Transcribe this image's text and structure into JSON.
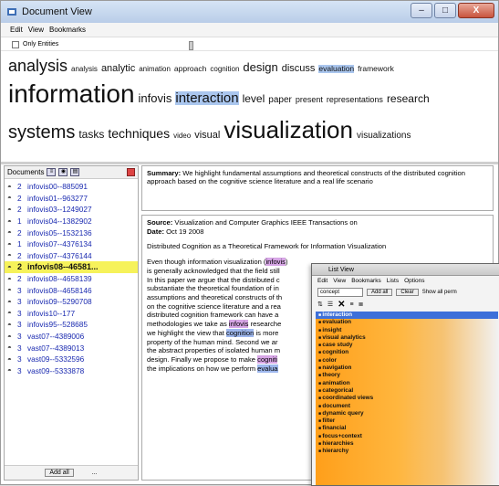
{
  "window": {
    "title": "Document View",
    "buttons": [
      "–",
      "□",
      "X"
    ]
  },
  "menu": [
    "Edit",
    "View",
    "Bookmarks"
  ],
  "options": {
    "only_entities_label": "Only Entities"
  },
  "cloud": {
    "line1": [
      {
        "text": "analysis",
        "size": 18
      },
      {
        "text": "analysis",
        "size": 8
      },
      {
        "text": "analytic",
        "size": 11
      },
      {
        "text": "animation",
        "size": 8
      },
      {
        "text": "approach",
        "size": 8.5
      },
      {
        "text": "cognition",
        "size": 8
      },
      {
        "text": "design",
        "size": 13
      },
      {
        "text": "discuss",
        "size": 11
      },
      {
        "text": "evaluation",
        "size": 8.5,
        "highlight": true
      },
      {
        "text": "framework",
        "size": 8.5
      }
    ],
    "line2": [
      {
        "text": "information",
        "size": 28
      },
      {
        "text": "infovis",
        "size": 13
      },
      {
        "text": "interaction",
        "size": 15,
        "highlight": true
      },
      {
        "text": "level",
        "size": 12
      },
      {
        "text": "paper",
        "size": 10
      },
      {
        "text": "present",
        "size": 9
      },
      {
        "text": "representations",
        "size": 9
      },
      {
        "text": "research",
        "size": 12
      }
    ],
    "line3": [
      {
        "text": "systems",
        "size": 20
      },
      {
        "text": "tasks",
        "size": 12
      },
      {
        "text": "techniques",
        "size": 14
      },
      {
        "text": "video",
        "size": 8
      },
      {
        "text": "visual",
        "size": 11
      },
      {
        "text": "visualization",
        "size": 26
      },
      {
        "text": "visualizations",
        "size": 10
      }
    ]
  },
  "documents": {
    "header": "Documents",
    "add_all_label": "Add all",
    "more_label": "...",
    "items": [
      {
        "count": "2",
        "name": "infovis00--885091"
      },
      {
        "count": "2",
        "name": "infovis01--963277"
      },
      {
        "count": "2",
        "name": "infovis03--1249027"
      },
      {
        "count": "1",
        "name": "infovis04--1382902"
      },
      {
        "count": "2",
        "name": "infovis05--1532136"
      },
      {
        "count": "1",
        "name": "infovis07--4376134"
      },
      {
        "count": "2",
        "name": "infovis07--4376144"
      },
      {
        "count": "2",
        "name": "infovis08--46581...",
        "selected": true
      },
      {
        "count": "2",
        "name": "infovis08--4658139"
      },
      {
        "count": "3",
        "name": "infovis08--4658146"
      },
      {
        "count": "3",
        "name": "infovis09--5290708"
      },
      {
        "count": "3",
        "name": "infovis10--177"
      },
      {
        "count": "3",
        "name": "infovis95--528685"
      },
      {
        "count": "3",
        "name": "vast07--4389006"
      },
      {
        "count": "3",
        "name": "vast07--4389013"
      },
      {
        "count": "3",
        "name": "vast09--5332596"
      },
      {
        "count": "3",
        "name": "vast09--5333878"
      }
    ]
  },
  "summary": {
    "label": "Summary:",
    "text": "We highlight fundamental assumptions and theoretical constructs of the distributed cognition approach based on the cognitive science literature and a real life scenario"
  },
  "source": {
    "source_label": "Source:",
    "source_text": "Visualization and Computer Graphics IEEE Transactions on",
    "date_label": "Date:",
    "date_text": "Oct 19 2008",
    "doc_title": "Distributed Cognition as a Theoretical Framework for Information Visualization",
    "abstract_lines": [
      "Even though information visualization (infovis)",
      "is generally acknowledged that the field still",
      "In this paper we argue that the distributed c",
      "substantiate the theoretical foundation of in",
      "assumptions and theoretical constructs of th",
      "on the cognitive science literature and a rea",
      "distributed cognition framework can have a",
      "methodologies we take as infovis researche",
      "we highlight the view that cognition is more",
      "property of the human mind. Second we ar",
      "the abstract properties of isolated human m",
      "design. Finally we propose to make cogniti",
      "the implications on how we perform evalua"
    ]
  },
  "list_view": {
    "title": "List View",
    "menu": [
      "Edit",
      "View",
      "Bookmarks",
      "Lists",
      "Options"
    ],
    "select_value": "concept",
    "add_all_label": "Add all",
    "clear_label": "Clear",
    "show_all_label": "Show all perm",
    "items": [
      "interaction",
      "evaluation",
      "insight",
      "visual analytics",
      "case study",
      "cognition",
      "color",
      "navigation",
      "theory",
      "animation",
      "categorical",
      "coordinated views",
      "document",
      "dynamic query",
      "filter",
      "financial",
      "focus+context",
      "hierarchies",
      "hierarchy"
    ]
  },
  "colors": {
    "selected_doc": "#f6f25a",
    "highlight_blue": "#aac6ee",
    "doc_link": "#1a2ab0",
    "list_orange": "#ff9f1a"
  }
}
